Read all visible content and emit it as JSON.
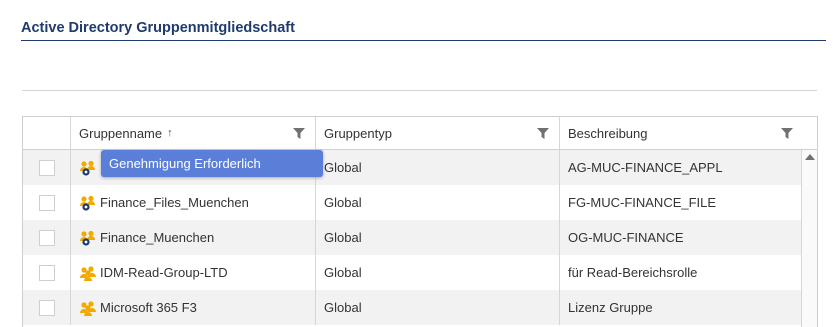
{
  "page": {
    "title": "Active Directory Gruppenmitgliedschaft"
  },
  "grid": {
    "columns": [
      {
        "label": "Gruppenname",
        "sorted": "ascending",
        "sort_icon": "sort-ascending-icon",
        "filter_icon": "filter-icon"
      },
      {
        "label": "Gruppentyp",
        "filter_icon": "filter-icon"
      },
      {
        "label": "Beschreibung",
        "filter_icon": "filter-icon"
      }
    ],
    "rows": [
      {
        "name": "",
        "type": "Global",
        "description": "AG-MUC-FINANCE_APPL",
        "icon": "group-lock-icon",
        "selected": false
      },
      {
        "name": "Finance_Files_Muenchen",
        "type": "Global",
        "description": "FG-MUC-FINANCE_FILE",
        "icon": "group-lock-icon",
        "selected": false
      },
      {
        "name": "Finance_Muenchen",
        "type": "Global",
        "description": "OG-MUC-FINANCE",
        "icon": "group-lock-icon",
        "selected": false
      },
      {
        "name": "IDM-Read-Group-LTD",
        "type": "Global",
        "description": "für Read-Bereichsrolle",
        "icon": "group-icon",
        "selected": false
      },
      {
        "name": "Microsoft 365 F3",
        "type": "Global",
        "description": "Lizenz Gruppe",
        "icon": "group-icon",
        "selected": false
      }
    ]
  },
  "tooltip": {
    "text": "Genehmigung Erforderlich"
  },
  "colors": {
    "title": "#1f3b6d",
    "tooltip_bg": "#5b7fd8",
    "sort_icon": "#2b5797",
    "group_icon": "#f2a900",
    "lock_icon": "#1f3b6d"
  }
}
